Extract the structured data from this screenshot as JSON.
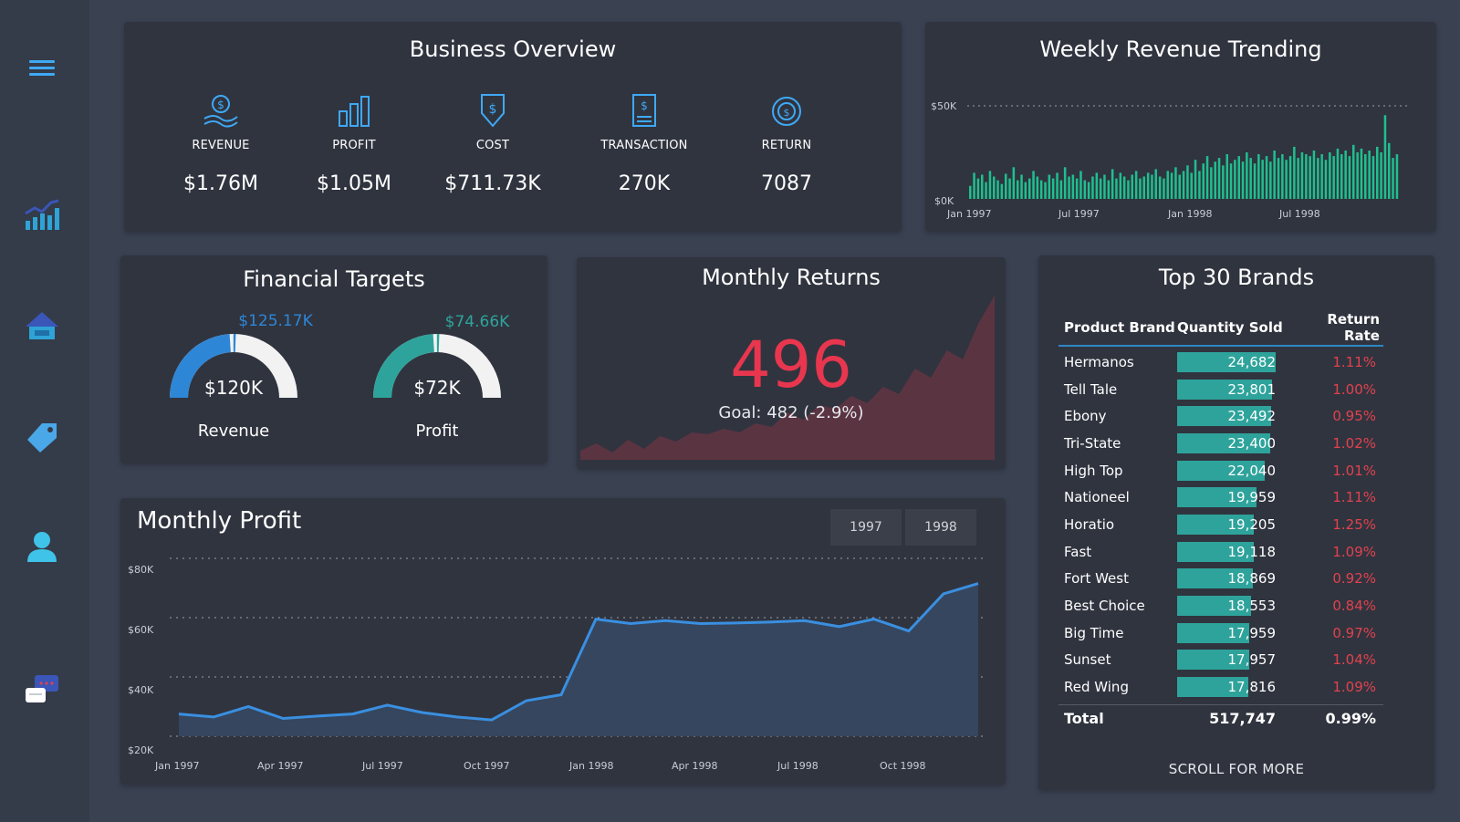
{
  "sidebar": {
    "icons": [
      "menu-icon",
      "chart-icon",
      "basket-icon",
      "tag-icon",
      "user-icon",
      "chat-icon"
    ]
  },
  "business_overview": {
    "title": "Business Overview",
    "kpis": [
      {
        "label": "REVENUE",
        "value": "$1.76M",
        "icon": "revenue-icon"
      },
      {
        "label": "PROFIT",
        "value": "$1.05M",
        "icon": "profit-icon"
      },
      {
        "label": "COST",
        "value": "$711.73K",
        "icon": "cost-icon"
      },
      {
        "label": "TRANSACTION",
        "value": "270K",
        "icon": "transaction-icon"
      },
      {
        "label": "RETURN",
        "value": "7087",
        "icon": "return-icon"
      }
    ]
  },
  "weekly_revenue": {
    "title": "Weekly Revenue Trending",
    "y_labels": [
      "$50K",
      "$0K"
    ],
    "x_labels": [
      "Jan 1997",
      "Jul 1997",
      "Jan 1998",
      "Jul 1998"
    ],
    "bar_color": "#1fbf8f"
  },
  "financial_targets": {
    "title": "Financial Targets",
    "gauges": [
      {
        "label": "Revenue",
        "value_label": "$120K",
        "target_label": "$125.17K",
        "value": 120,
        "max": 250,
        "color": "#2e86d6",
        "target_color": "#2e86d6"
      },
      {
        "label": "Profit",
        "value_label": "$72K",
        "target_label": "$74.66K",
        "value": 72,
        "max": 150,
        "color": "#2ea39b",
        "target_color": "#2ea39b"
      }
    ]
  },
  "monthly_returns": {
    "title": "Monthly Returns",
    "value": "496",
    "goal": "Goal: 482 (-2.9%)",
    "value_color": "#e8364e"
  },
  "monthly_profit": {
    "title": "Monthly Profit",
    "buttons": [
      "1997",
      "1998"
    ],
    "y_ticks": [
      "$80K",
      "$60K",
      "$40K",
      "$20K"
    ],
    "x_ticks": [
      "Jan 1997",
      "Apr 1997",
      "Jul 1997",
      "Oct 1997",
      "Jan 1998",
      "Apr 1998",
      "Jul 1998",
      "Oct 1998"
    ]
  },
  "top_brands": {
    "title": "Top 30 Brands",
    "columns": [
      "Product Brand",
      "Quantity Sold",
      "Return Rate"
    ],
    "rows": [
      {
        "brand": "Hermanos",
        "qty": "24,682",
        "rate": "1.11%"
      },
      {
        "brand": "Tell Tale",
        "qty": "23,801",
        "rate": "1.00%"
      },
      {
        "brand": "Ebony",
        "qty": "23,492",
        "rate": "0.95%"
      },
      {
        "brand": "Tri-State",
        "qty": "23,400",
        "rate": "1.02%"
      },
      {
        "brand": "High Top",
        "qty": "22,040",
        "rate": "1.01%"
      },
      {
        "brand": "Nationeel",
        "qty": "19,959",
        "rate": "1.11%"
      },
      {
        "brand": "Horatio",
        "qty": "19,205",
        "rate": "1.25%"
      },
      {
        "brand": "Fast",
        "qty": "19,118",
        "rate": "1.09%"
      },
      {
        "brand": "Fort West",
        "qty": "18,869",
        "rate": "0.92%"
      },
      {
        "brand": "Best Choice",
        "qty": "18,553",
        "rate": "0.84%"
      },
      {
        "brand": "Big Time",
        "qty": "17,959",
        "rate": "0.97%"
      },
      {
        "brand": "Sunset",
        "qty": "17,957",
        "rate": "1.04%"
      },
      {
        "brand": "Red Wing",
        "qty": "17,816",
        "rate": "1.09%"
      }
    ],
    "total_label": "Total",
    "total_qty": "517,747",
    "total_rate": "0.99%",
    "scroll_label": "SCROLL FOR MORE"
  },
  "chart_data": [
    {
      "type": "bar",
      "title": "Weekly Revenue Trending",
      "ylim": [
        0,
        50000
      ],
      "x_labels": [
        "Jan 1997",
        "Jul 1997",
        "Jan 1998",
        "Jul 1998"
      ],
      "values": [
        14,
        28,
        22,
        26,
        18,
        30,
        24,
        20,
        16,
        27,
        22,
        34,
        20,
        26,
        18,
        22,
        30,
        24,
        20,
        18,
        26,
        22,
        28,
        20,
        34,
        24,
        26,
        22,
        30,
        20,
        18,
        24,
        28,
        22,
        26,
        20,
        32,
        22,
        28,
        24,
        20,
        26,
        30,
        22,
        24,
        28,
        26,
        32,
        24,
        22,
        30,
        28,
        34,
        26,
        30,
        36,
        28,
        42,
        30,
        38,
        46,
        34,
        40,
        44,
        36,
        48,
        38,
        42,
        46,
        40,
        50,
        44,
        38,
        48,
        42,
        46,
        40,
        52,
        44,
        48,
        42,
        46,
        56,
        44,
        50,
        48,
        46,
        52,
        44,
        48,
        42,
        50,
        46,
        54,
        48,
        52,
        46,
        58,
        50,
        54,
        48,
        52,
        46,
        56,
        50,
        90,
        60,
        44,
        48
      ]
    },
    {
      "type": "line",
      "title": "Monthly Profit",
      "ylim": [
        20000,
        80000
      ],
      "x": [
        "Jan 1997",
        "Feb 1997",
        "Mar 1997",
        "Apr 1997",
        "May 1997",
        "Jun 1997",
        "Jul 1997",
        "Aug 1997",
        "Sep 1997",
        "Oct 1997",
        "Nov 1997",
        "Dec 1997",
        "Jan 1998",
        "Feb 1998",
        "Mar 1998",
        "Apr 1998",
        "May 1998",
        "Jun 1998",
        "Jul 1998",
        "Aug 1998",
        "Sep 1998",
        "Oct 1998",
        "Nov 1998",
        "Dec 1998"
      ],
      "values": [
        27500,
        26500,
        30000,
        26000,
        26800,
        27500,
        30500,
        28000,
        26500,
        25500,
        32000,
        34000,
        59500,
        58000,
        59000,
        58000,
        58200,
        58500,
        59000,
        57000,
        59500,
        55500,
        68000,
        71500
      ]
    },
    {
      "type": "area",
      "title": "Monthly Returns",
      "values": [
        10,
        18,
        8,
        22,
        12,
        26,
        20,
        30,
        28,
        34,
        30,
        40,
        36,
        52,
        44,
        60,
        56,
        70,
        62,
        80,
        72,
        100,
        90,
        120,
        110,
        150,
        180
      ]
    }
  ]
}
